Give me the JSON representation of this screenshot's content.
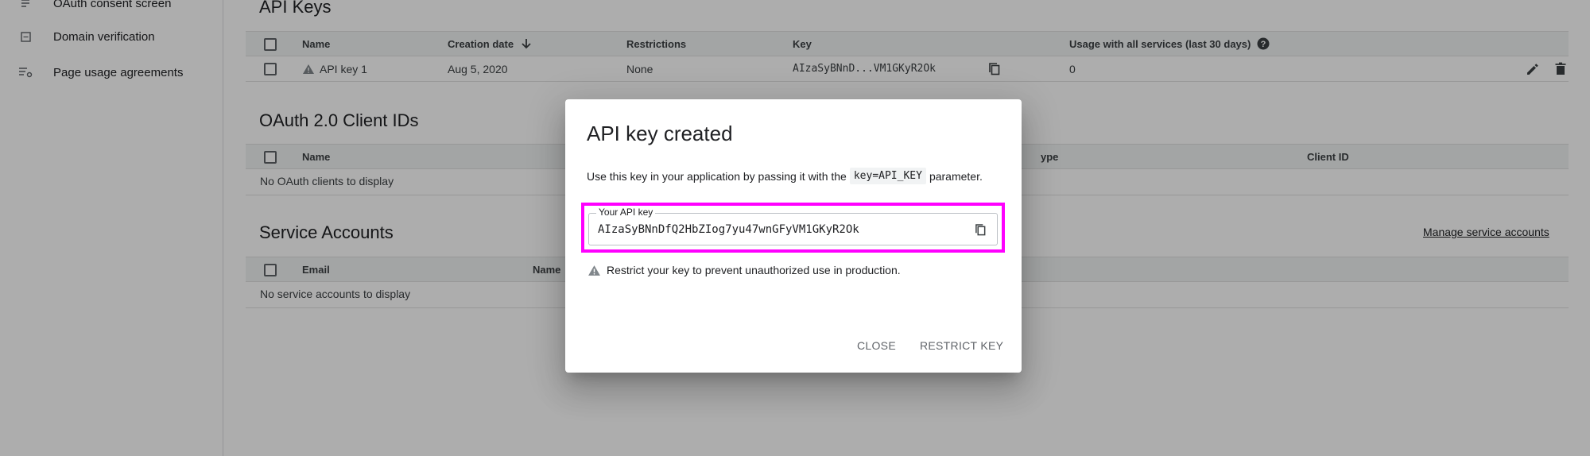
{
  "sidebar": {
    "items": [
      {
        "label": "OAuth consent screen",
        "icon": "consent-icon"
      },
      {
        "label": "Domain verification",
        "icon": "checkbox-square-icon"
      },
      {
        "label": "Page usage agreements",
        "icon": "settings-list-icon"
      }
    ]
  },
  "api_keys": {
    "title": "API Keys",
    "headers": {
      "name": "Name",
      "creation_date": "Creation date",
      "restrictions": "Restrictions",
      "key": "Key",
      "usage": "Usage with all services (last 30 days)"
    },
    "rows": [
      {
        "name": "API key 1",
        "creation_date": "Aug 5, 2020",
        "restrictions": "None",
        "key": "AIzaSyBNnD...VM1GKyR2Ok",
        "usage": "0"
      }
    ]
  },
  "oauth": {
    "title": "OAuth 2.0 Client IDs",
    "headers": {
      "name": "Name",
      "type": "Type",
      "client_id": "Client ID"
    },
    "type_visible": "ype",
    "empty": "No OAuth clients to display"
  },
  "service_accounts": {
    "title": "Service Accounts",
    "manage_link": "Manage service accounts",
    "headers": {
      "email": "Email",
      "name": "Name"
    },
    "empty": "No service accounts to display"
  },
  "dialog": {
    "title": "API key created",
    "desc_before": "Use this key in your application by passing it with the",
    "desc_code": "key=API_KEY",
    "desc_after": "parameter.",
    "key_label": "Your API key",
    "key_value": "AIzaSyBNnDfQ2HbZIog7yu47wnGFyVM1GKyR2Ok",
    "warning": "Restrict your key to prevent unauthorized use in production.",
    "close_label": "CLOSE",
    "restrict_label": "RESTRICT KEY"
  },
  "colors": {
    "highlight": "#ff00ff",
    "scrim": "rgba(0,0,0,0.32)"
  }
}
